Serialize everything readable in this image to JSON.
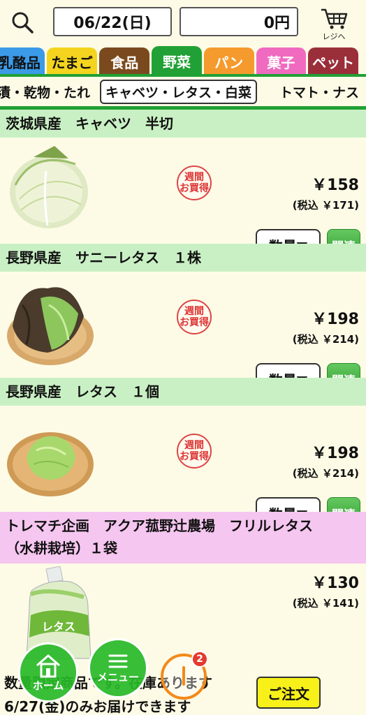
{
  "header": {
    "date": "06/22(日)",
    "cart_total": "0円",
    "cart_label": "レジへ",
    "icons": {
      "search": "search-icon",
      "cart": "cart-icon"
    }
  },
  "category_tabs": [
    {
      "label": "乳酪品",
      "color": "#3b9be8",
      "text_color": "#111111"
    },
    {
      "label": "たまご",
      "color": "#f4d41e",
      "text_color": "#111111"
    },
    {
      "label": "食品",
      "color": "#7a4a1e",
      "text_color": "#ffffff"
    },
    {
      "label": "野菜",
      "color": "#21a035",
      "text_color": "#ffffff",
      "active": true
    },
    {
      "label": "パン",
      "color": "#f59a2c",
      "text_color": "#ffffff"
    },
    {
      "label": "菓子",
      "color": "#f06ac0",
      "text_color": "#ffffff"
    },
    {
      "label": "ペット",
      "color": "#9a2f3a",
      "text_color": "#ffffff"
    }
  ],
  "sub_tabs": [
    {
      "label": "漬・乾物・たれ"
    },
    {
      "label": "キャベツ・レタス・白菜",
      "active": true
    },
    {
      "label": "トマト・ナス"
    }
  ],
  "products": [
    {
      "name": "茨城県産　キャベツ　半切",
      "price": "￥158",
      "tax_price": "(税込 ￥171)",
      "badge_line1": "週間",
      "badge_line2": "お買得",
      "qty_label": "数量▼",
      "related_label": "関連",
      "image": "cabbage-half"
    },
    {
      "name": "長野県産　サニーレタス　１株",
      "price": "￥198",
      "tax_price": "(税込 ￥214)",
      "badge_line1": "週間",
      "badge_line2": "お買得",
      "qty_label": "数量▼",
      "related_label": "関連",
      "image": "sunny-lettuce"
    },
    {
      "name": "長野県産　レタス　１個",
      "price": "￥198",
      "tax_price": "(税込 ￥214)",
      "badge_line1": "週間",
      "badge_line2": "お買得",
      "qty_label": "数量▼",
      "related_label": "関連",
      "image": "lettuce"
    },
    {
      "name_line1": "トレマチ企画　アクア菰野辻農場　フリルレタス",
      "name_line2": "（水耕栽培）１袋",
      "price": "￥130",
      "tax_price": "(税込 ￥141)",
      "order_label": "ご注文",
      "stock_text": "数量限定商品です。在庫あります",
      "delivery_text": "6/27(金)のみお届けできます",
      "image": "frill-lettuce-bag",
      "bag_text": "レタス"
    }
  ],
  "nav": {
    "home_label": "ホーム",
    "menu_label": "メニュー",
    "history_count": "2"
  },
  "colors": {
    "background": "#fdfbe6",
    "accent_green": "#21a035",
    "header_green": "#c9f0c4",
    "header_pink": "#f5c6f0",
    "order_yellow": "#f7f019",
    "badge_red": "#d33333"
  }
}
